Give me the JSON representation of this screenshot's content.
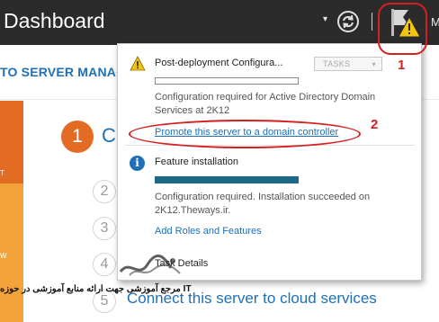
{
  "header": {
    "title": "Dashboard",
    "menu_manage_partial": "M",
    "dropdown_glyph": "▾"
  },
  "welcome": {
    "banner": "TO SERVER MANAG"
  },
  "left_strip": {
    "item_a": "T",
    "item_b": "W"
  },
  "steps": [
    {
      "number": "1",
      "label": "C"
    },
    {
      "number": "2",
      "label": ""
    },
    {
      "number": "3",
      "label": ""
    },
    {
      "number": "4",
      "label": ""
    },
    {
      "number": "5",
      "label": "Connect this server to cloud services"
    }
  ],
  "notifications": {
    "deployment": {
      "title": "Post-deployment Configura...",
      "tasks_button": "TASKS",
      "tasks_caret": "▾",
      "description": "Configuration required for Active Directory Domain Services at 2K12",
      "link": "Promote this server to a domain controller"
    },
    "feature": {
      "icon_glyph": "i",
      "title": "Feature installation",
      "progress": 1.0,
      "description": "Configuration required. Installation succeeded on 2K12.Theways.ir.",
      "link": "Add Roles and Features"
    },
    "task_details": "Task Details"
  },
  "annotations": {
    "label_1": "1",
    "label_2": "2",
    "color": "#d42020"
  },
  "watermark": {
    "text": "مرجع آموزشی جهت ارائه منابع آموزشی در حوزه IT"
  },
  "colors": {
    "topbar": "#2b2b2b",
    "accent_blue": "#1f6fb6",
    "orange": "#e36c25",
    "amber": "#f4a23a",
    "warning_yellow": "#f1c40f",
    "progress_teal": "#1c6a88"
  },
  "icons": {
    "refresh": "refresh-icon",
    "flag": "notification-flag-icon",
    "warning": "warning-icon",
    "info": "info-icon"
  }
}
